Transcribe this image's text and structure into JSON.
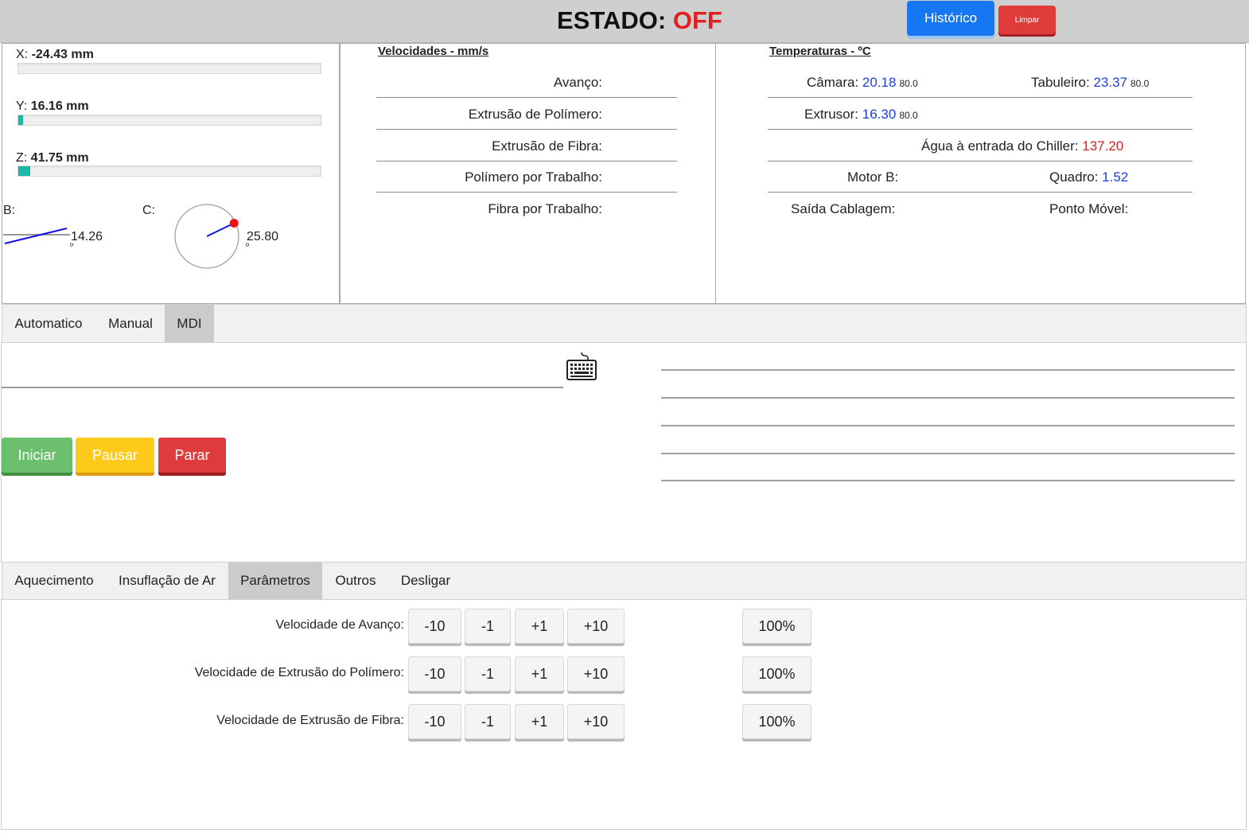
{
  "header": {
    "estado_label": "ESTADO:",
    "estado_value": "OFF",
    "historico_label": "Histórico",
    "limpar_label": "Limpar",
    "colors": {
      "off": "#e02020",
      "historico": "#1577f2",
      "limpar": "#e03b3b"
    }
  },
  "axes": {
    "x": {
      "label": "X:",
      "value": "-24.43 mm",
      "progress": 0.0
    },
    "y": {
      "label": "Y:",
      "value": "16.16 mm",
      "progress": 0.015
    },
    "z": {
      "label": "Z:",
      "value": "41.75 mm",
      "progress": 0.04
    },
    "b": {
      "label": "B:",
      "value": "14.26",
      "unit": "º",
      "angle_deg": 14.26
    },
    "c": {
      "label": "C:",
      "value": "25.80",
      "unit": "º",
      "angle_deg": 25.8
    }
  },
  "velocidades": {
    "title": "Velocidades - mm/s",
    "rows": [
      "Avanço:",
      "Extrusão de Polímero:",
      "Extrusão de Fibra:",
      "Polímero por Trabalho:",
      "Fibra por Trabalho:"
    ]
  },
  "temperaturas": {
    "title": "Temperaturas - ºC",
    "camara": {
      "label": "Câmara:",
      "value": "20.18",
      "setpoint": "80.0"
    },
    "tabuleiro": {
      "label": "Tabuleiro:",
      "value": "23.37",
      "setpoint": "80.0"
    },
    "extrusor": {
      "label": "Extrusor:",
      "value": "16.30",
      "setpoint": "80.0"
    },
    "agua": {
      "label": "Água à entrada do Chiller:",
      "value": "137.20"
    },
    "motor_b": {
      "label": "Motor B:"
    },
    "quadro": {
      "label": "Quadro:",
      "value": "1.52"
    },
    "saida": {
      "label": "Saída Cablagem:"
    },
    "ponto": {
      "label": "Ponto Móvel:"
    }
  },
  "mode_tabs": [
    "Automatico",
    "Manual",
    "MDI"
  ],
  "mode_active": "MDI",
  "controls": {
    "iniciar": "Iniciar",
    "pausar": "Pausar",
    "parar": "Parar"
  },
  "bottom_tabs": [
    "Aquecimento",
    "Insuflação de Ar",
    "Parâmetros",
    "Outros",
    "Desligar"
  ],
  "bottom_active": "Parâmetros",
  "parametros": [
    {
      "label": "Velocidade de Avanço:",
      "steps": [
        "-10",
        "-1",
        "+1",
        "+10"
      ],
      "percent": "100%"
    },
    {
      "label": "Velocidade de Extrusão do Polímero:",
      "steps": [
        "-10",
        "-1",
        "+1",
        "+10"
      ],
      "percent": "100%"
    },
    {
      "label": "Velocidade de Extrusão de Fibra:",
      "steps": [
        "-10",
        "-1",
        "+1",
        "+10"
      ],
      "percent": "100%"
    }
  ]
}
